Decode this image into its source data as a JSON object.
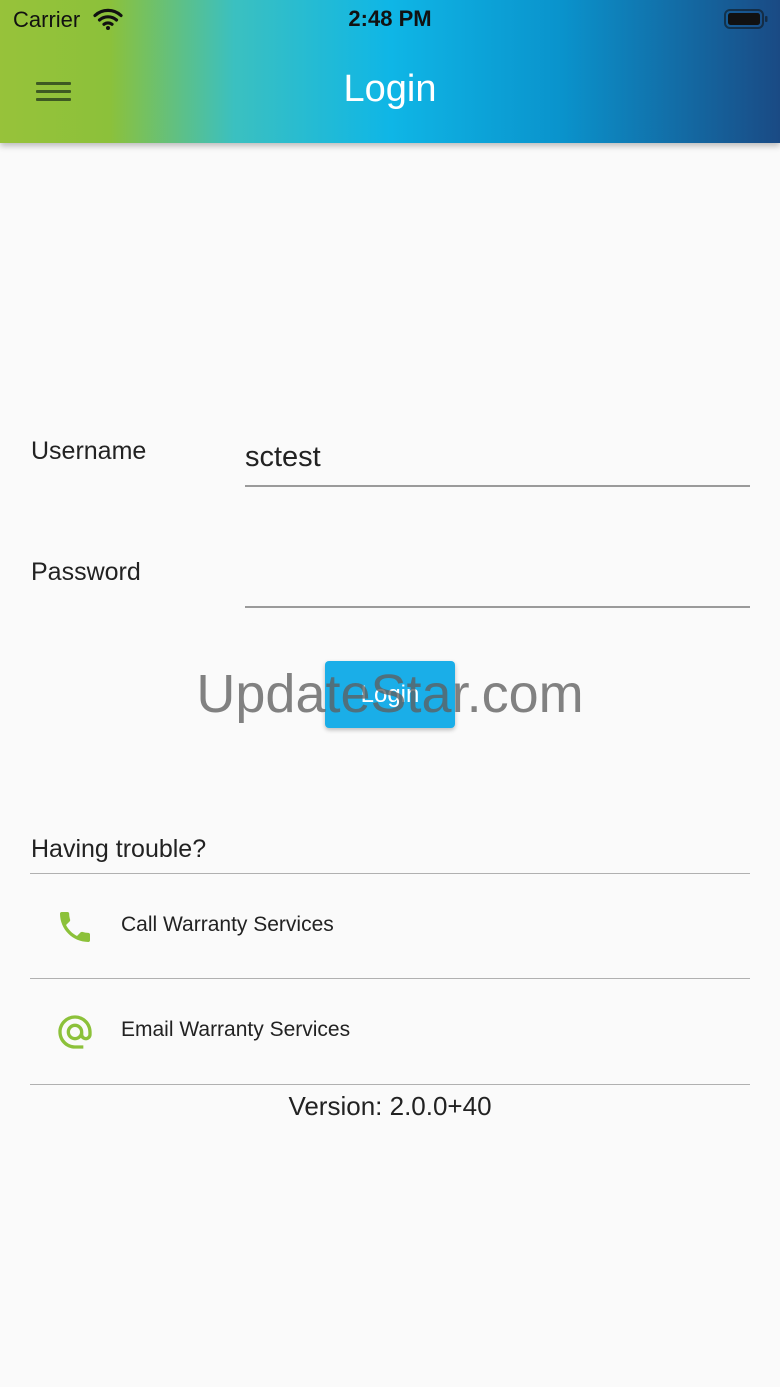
{
  "status_bar": {
    "carrier": "Carrier",
    "time": "2:48 PM"
  },
  "header": {
    "title": "Login",
    "menu_icon": "hamburger-menu-icon"
  },
  "form": {
    "username_label": "Username",
    "username_value": "sctest",
    "password_label": "Password",
    "password_value": "",
    "login_label": "Login"
  },
  "watermark": "UpdateStar.com",
  "support": {
    "heading": "Having trouble?",
    "items": [
      {
        "label": "Call Warranty Services",
        "icon": "phone-icon"
      },
      {
        "label": "Email Warranty Services",
        "icon": "at-sign-icon"
      }
    ]
  },
  "version": "Version: 2.0.0+40",
  "colors": {
    "header_gradient_start": "#97c23a",
    "header_gradient_mid": "#0fb6e6",
    "header_gradient_end": "#1a4a84",
    "button": "#1aaee8",
    "icon_green": "#8cc13a"
  }
}
